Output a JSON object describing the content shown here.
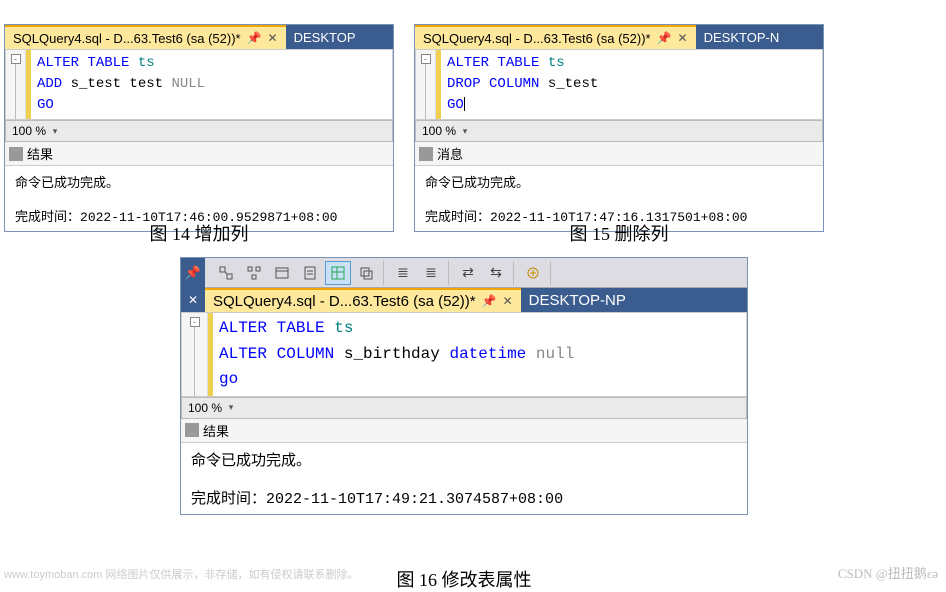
{
  "panel1": {
    "tab_title": "SQLQuery4.sql - D...63.Test6 (sa (52))*",
    "tab_inactive": "DESKTOP",
    "code": {
      "l1a": "ALTER",
      "l1b": "TABLE",
      "l1c": "ts",
      "l2a": "ADD",
      "l2b": "s_test test",
      "l2c": "NULL",
      "l3a": "GO"
    },
    "zoom": "100 %",
    "results_label": "结果",
    "msg": "命令已成功完成。",
    "time_label": "完成时间：",
    "time_val": "2022-11-10T17:46:00.9529871+08:00",
    "caption": "图 14  增加列"
  },
  "panel2": {
    "tab_title": "SQLQuery4.sql - D...63.Test6 (sa (52))*",
    "tab_inactive": "DESKTOP-N",
    "code": {
      "l1a": "ALTER",
      "l1b": "TABLE",
      "l1c": "ts",
      "l2a": "DROP",
      "l2b": "COLUMN",
      "l2c": "s_test",
      "l3a": "GO"
    },
    "zoom": "100 %",
    "results_label": "消息",
    "msg": "命令已成功完成。",
    "time_label": "完成时间：",
    "time_val": "2022-11-10T17:47:16.1317501+08:00",
    "caption": "图 15  删除列"
  },
  "panel3": {
    "tab_title": "SQLQuery4.sql - D...63.Test6 (sa (52))*",
    "tab_inactive": "DESKTOP-NP",
    "code": {
      "l1a": "ALTER",
      "l1b": "TABLE",
      "l1c": "ts",
      "l2a": "ALTER",
      "l2b": "COLUMN",
      "l2c": "s_birthday",
      "l2d": "datetime",
      "l2e": "null",
      "l3a": "go"
    },
    "zoom": "100 %",
    "results_label": "结果",
    "msg": "命令已成功完成。",
    "time_label": "完成时间：",
    "time_val": "2022-11-10T17:49:21.3074587+08:00",
    "caption": "图 16  修改表属性"
  },
  "watermark1a": "www.toymoban.com",
  "watermark1b": "  网络图片仅供展示，非存储，如有侵权请联系删除。",
  "watermark2": "CSDN @扭扭鹅εə"
}
